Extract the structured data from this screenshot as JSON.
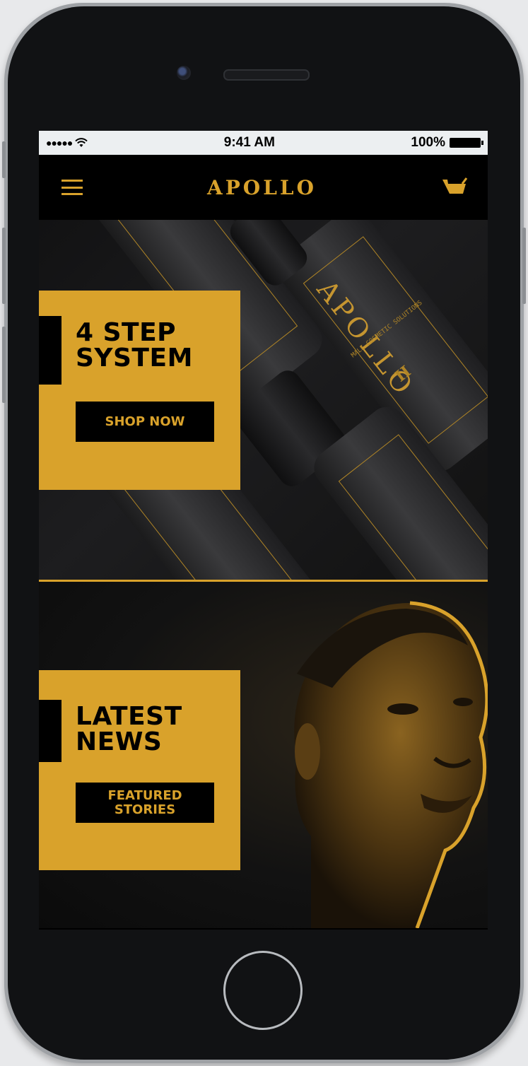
{
  "status_bar": {
    "signal": "●●●●●",
    "time": "9:41 AM",
    "battery": "100%"
  },
  "navbar": {
    "logo": "APOLLO"
  },
  "hero": {
    "heading_line1": "4 STEP",
    "heading_line2": "SYSTEM",
    "cta": "SHOP NOW",
    "product_brand": "APOLLO",
    "product_text": "MALE COSMETIC SOLUTIONS",
    "product_roman": "II"
  },
  "news": {
    "heading_line1": "LATEST",
    "heading_line2": "NEWS",
    "cta_line1": "FEATURED",
    "cta_line2": "STORIES"
  },
  "colors": {
    "accent": "#d9a22b",
    "background": "#000000"
  }
}
